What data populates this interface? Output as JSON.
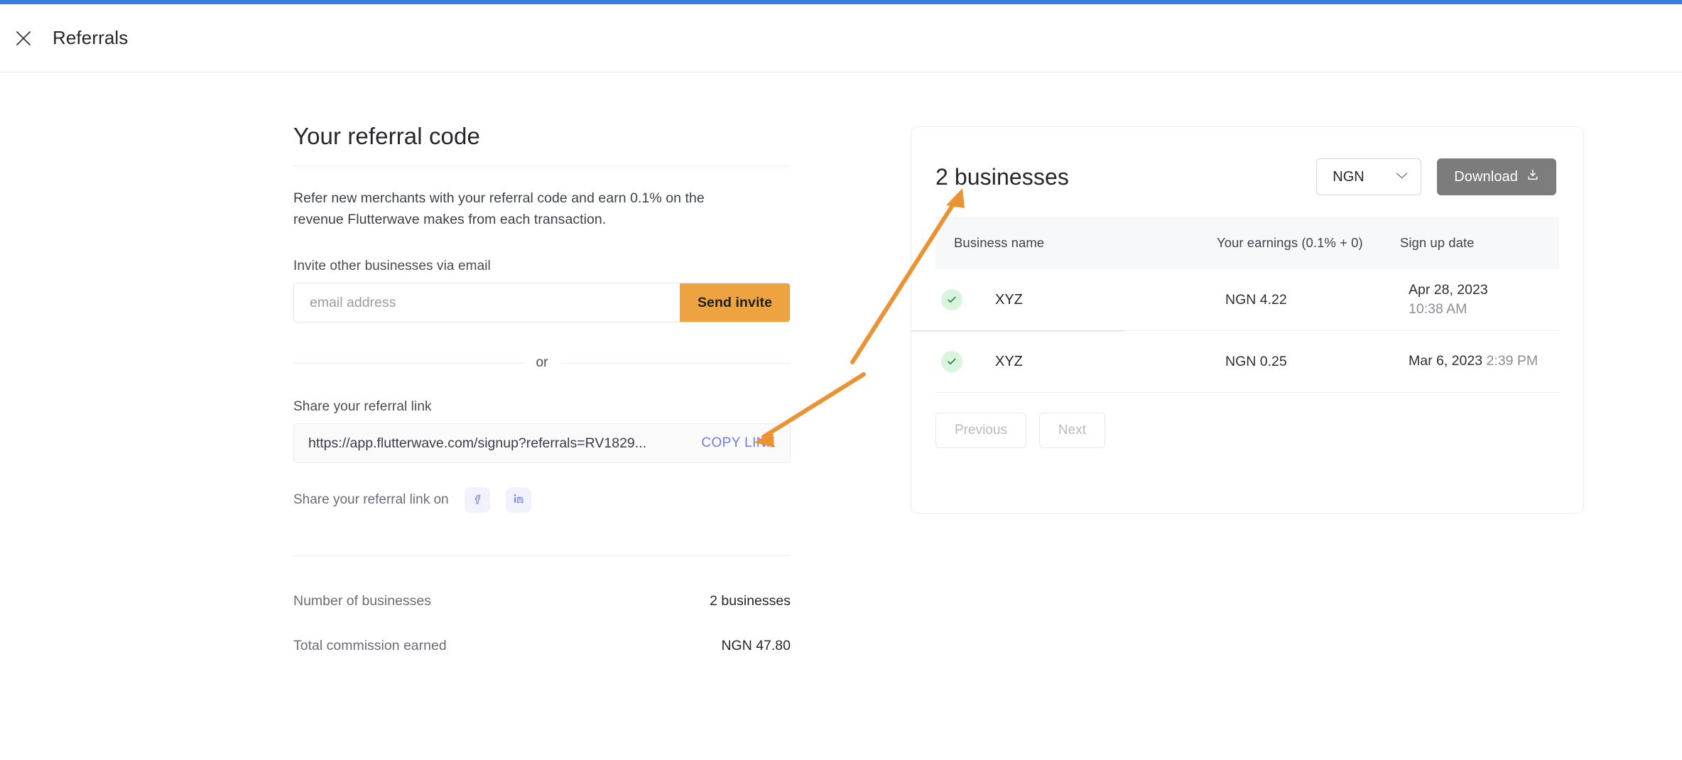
{
  "header": {
    "title": "Referrals",
    "close_icon": "close-icon"
  },
  "left": {
    "section_title": "Your referral code",
    "intro": "Refer new merchants with your referral code and earn 0.1% on the revenue Flutterwave makes from each transaction.",
    "invite_label": "Invite other businesses via email",
    "email_placeholder": "email address",
    "email_value": "",
    "send_invite_label": "Send invite",
    "or_label": "or",
    "share_link_label": "Share your referral link",
    "referral_link": "https://app.flutterwave.com/signup?referrals=RV1829...",
    "copy_link_label": "COPY LINK",
    "share_on_label": "Share your referral link on",
    "socials": [
      {
        "name": "facebook-icon",
        "label": "Facebook"
      },
      {
        "name": "linkedin-icon",
        "label": "LinkedIn"
      }
    ],
    "summary": [
      {
        "label": "Number of businesses",
        "value": "2 businesses"
      },
      {
        "label": "Total commission earned",
        "value": "NGN 47.80"
      }
    ]
  },
  "right": {
    "count_title": "2 businesses",
    "currency_selected": "NGN",
    "currency_options": [
      "NGN"
    ],
    "download_label": "Download",
    "download_icon": "download-icon",
    "columns": [
      "Business name",
      "Your earnings (0.1% + 0)",
      "Sign up date"
    ],
    "rows": [
      {
        "status_icon": "check-circle-icon",
        "business_name": "XYZ",
        "earnings": "NGN 4.22",
        "date": "Apr 28, 2023",
        "time": "10:38 AM",
        "date_layout": "stacked"
      },
      {
        "status_icon": "check-circle-icon",
        "business_name": "XYZ",
        "earnings": "NGN 0.25",
        "date": "Mar 6, 2023",
        "time": "2:39 PM",
        "date_layout": "inline"
      }
    ],
    "pagination": {
      "previous_label": "Previous",
      "next_label": "Next"
    }
  },
  "colors": {
    "accent_orange": "#eda33f",
    "annotation_orange": "#eb9233",
    "loading_blue": "#3b7ddd",
    "link_purple": "#6f7ce8",
    "download_gray": "#7c7c7c",
    "success_green": "#d9f5de"
  }
}
